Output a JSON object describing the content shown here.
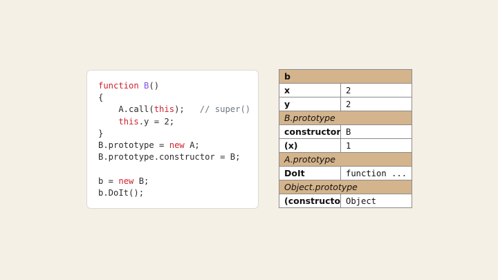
{
  "code": {
    "lines": [
      [
        {
          "t": "function",
          "c": "kw"
        },
        {
          "t": " "
        },
        {
          "t": "B",
          "c": "fn"
        },
        {
          "t": "()"
        }
      ],
      [
        {
          "t": "{"
        }
      ],
      [
        {
          "t": "    A.call("
        },
        {
          "t": "this",
          "c": "kw"
        },
        {
          "t": ");   "
        },
        {
          "t": "// super()",
          "c": "cm"
        }
      ],
      [
        {
          "t": "    "
        },
        {
          "t": "this",
          "c": "kw"
        },
        {
          "t": ".y = 2;"
        }
      ],
      [
        {
          "t": "}"
        }
      ],
      [
        {
          "t": "B.prototype = "
        },
        {
          "t": "new",
          "c": "kw"
        },
        {
          "t": " A;"
        }
      ],
      [
        {
          "t": "B.prototype.constructor = B;"
        }
      ],
      [],
      [
        {
          "t": "b = "
        },
        {
          "t": "new",
          "c": "kw"
        },
        {
          "t": " B;"
        }
      ],
      [
        {
          "t": "b.DoIt();"
        }
      ]
    ]
  },
  "colors": {
    "keyword": "#cf222e",
    "function_name": "#8250df",
    "comment": "#6e7781",
    "header_fill": "#d4b48c",
    "background": "#f5f0e6"
  },
  "table": {
    "sections": [
      {
        "header": "b",
        "italic": false,
        "rows": [
          {
            "key": "x",
            "value": "2"
          },
          {
            "key": "y",
            "value": "2"
          }
        ]
      },
      {
        "header": "B.prototype",
        "italic": true,
        "rows": [
          {
            "key": "constructor",
            "value": "B"
          },
          {
            "key": "(x)",
            "value": "1"
          }
        ]
      },
      {
        "header": "A.prototype",
        "italic": true,
        "rows": [
          {
            "key": "DoIt",
            "value": "function ..."
          }
        ]
      },
      {
        "header": "Object.prototype",
        "italic": true,
        "rows": [
          {
            "key": "(constructor)",
            "value": "Object"
          }
        ]
      }
    ]
  }
}
